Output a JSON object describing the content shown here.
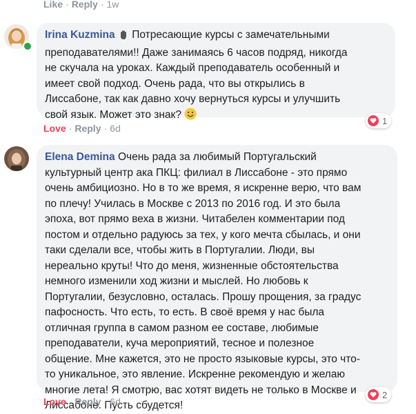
{
  "top_actions": {
    "like": "Like",
    "reply": "Reply",
    "time": "1w"
  },
  "comments": [
    {
      "author": "Irina Kuzmina",
      "lines": [
        "Потресающие курсы с замечательными",
        "преподавателями!! Даже занимаясь 6 часов подряд, никогда",
        "не скучала на уроках. Каждый преподаватель особенный и",
        "имеет свой подход. Очень рада, что вы открылись в",
        "Лиссабоне, так как давно хочу вернуться курсы и улучшить",
        "свой язык. Может это знак?"
      ],
      "online": true,
      "actions": {
        "love": "Love",
        "reply": "Reply",
        "time": "6d"
      },
      "reaction": {
        "icon": "heart-icon",
        "count": "1"
      }
    },
    {
      "author": "Elena Demina",
      "lines": [
        "Очень рада за любимый Португальский",
        "культурный центр ака ПКЦ: филиал в Лиссабоне - это прямо",
        "очень амбициозно. Но в то же время, я искренне верю, что вам",
        "по плечу! Училась в Москве с 2013 по 2016 год. И это была",
        "эпоха, вот прямо веха в жизни. Читабелен комментарии под",
        "постом и отдельно радуюсь за тех, у кого мечта сбылась, и они",
        "таки сделали все, чтобы жить в Португалии. Люди, вы",
        "нереально круты! Что до меня, жизненные обстоятельства",
        "немного изменили ход жизни и мыслей. Но любовь к",
        "Португалии, безусловно, осталась. Прошу прощения, за градус",
        "пафосность. Что есть, то есть. В своё время у нас была",
        "отличная группа в самом разном ее составе, любимые",
        "преподаватели, куча мероприятий, тесное и полезное",
        "общение. Мне кажется, это не просто языковые курсы, это что-",
        "то уникальное, это явление. Искренне рекомендую и желаю",
        "многие лета! Я смотрю, вас хотят видеть не только в Москве и",
        "Лиссабоне. Пусть сбудется!"
      ],
      "online": false,
      "actions": {
        "love": "Love",
        "reply": "Reply",
        "time": "6d"
      },
      "reaction": {
        "icon": "heart-icon",
        "count": "2"
      }
    }
  ],
  "colors": {
    "author": "#385898",
    "love": "#f33e58",
    "bubble": "#f2f3f5",
    "muted": "#8d949e",
    "online": "#31a24c"
  }
}
